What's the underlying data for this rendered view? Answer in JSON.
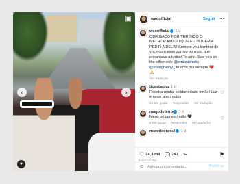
{
  "post": {
    "username": "waoofficial",
    "follow_label": "Seguir",
    "more_icon": "ellipsis-icon",
    "caption": {
      "user": "waoofficial",
      "time": "1 d",
      "text": "OBRIGADO POR TER SIDO O MELHOR AMIGO QUE EU PODERIA PEDIR A DEUS! Sempre vou lembrar de voce com esse sorriso no rosto que encantava a todos! Te amo. See you on the other side",
      "mentions": "@emilcashcita @frotography_",
      "tail": "te amo pra sempre ❤️🙏",
      "translation": "Ver tradução"
    },
    "comments": [
      {
        "user": "ticostacruz",
        "time": "1 d",
        "text": "Receba minha solidariedade irmão! Luz e amor aos irmãos",
        "likes": "41 Me gusta",
        "reply": "Responder",
        "translation": "Ver tradução"
      },
      {
        "user": "magodeferro",
        "time": "1 d",
        "text": "Meus pêsames irmão 🖤",
        "likes": "4 Me gusta",
        "reply": "Responder",
        "translation": "Ver tradução"
      },
      {
        "user": "mcrodsonreal",
        "time": "1 d",
        "text": "",
        "likes": "",
        "reply": "",
        "translation": ""
      }
    ],
    "actions": {
      "likes": "14,3 mil",
      "comments": "247"
    },
    "timestamp": "Hace un día",
    "comment_placeholder": "Agrega un comentario...",
    "post_label": "Publicar"
  },
  "colors": {
    "accent": "#0095f6",
    "verified": "#0095f6"
  }
}
